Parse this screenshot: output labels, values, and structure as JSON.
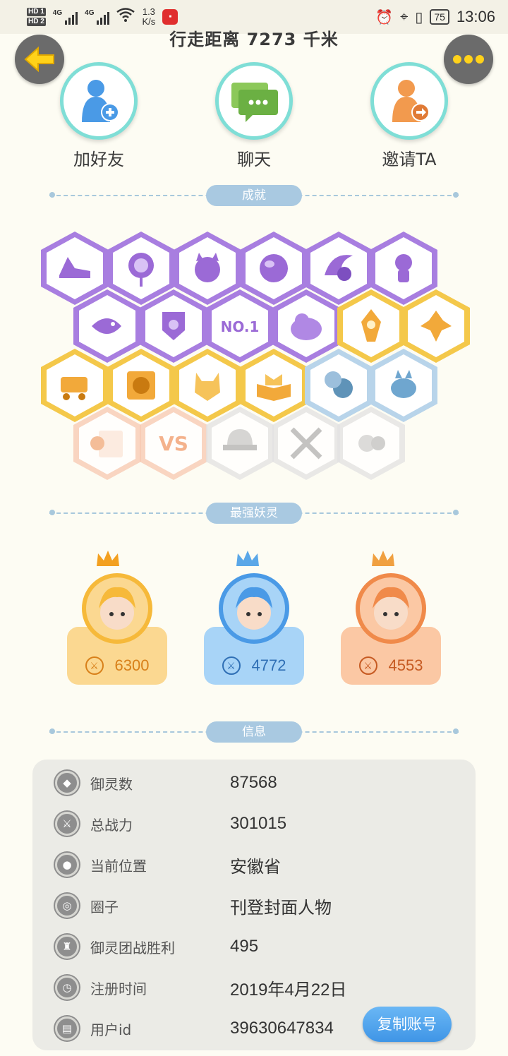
{
  "status_bar": {
    "hd1": "HD 1",
    "hd2": "HD 2",
    "sig1": "4G",
    "sig2": "4G",
    "speed_value": "1.3",
    "speed_unit": "K/s",
    "battery": "75",
    "time": "13:06"
  },
  "header": {
    "distance_text": "行走距离 7273 千米"
  },
  "actions": [
    {
      "label": "加好友",
      "icon": "add-friend-icon"
    },
    {
      "label": "聊天",
      "icon": "chat-icon"
    },
    {
      "label": "邀请TA",
      "icon": "invite-icon"
    }
  ],
  "sections": {
    "achievements": "成就",
    "strongest": "最强妖灵",
    "info": "信息"
  },
  "achievements": [
    {
      "icon": "shoe-icon",
      "color": "#a87ee0"
    },
    {
      "icon": "portal-icon",
      "color": "#a87ee0"
    },
    {
      "icon": "cat-face-icon",
      "color": "#a87ee0"
    },
    {
      "icon": "orb-icon",
      "color": "#a87ee0"
    },
    {
      "icon": "yin-yang-icon",
      "color": "#a87ee0"
    },
    {
      "icon": "cat-spirit-icon",
      "color": "#a87ee0"
    },
    {
      "icon": "fish-spirit-icon",
      "color": "#a87ee0"
    },
    {
      "icon": "shield-icon",
      "color": "#a87ee0"
    },
    {
      "icon": "no1-icon",
      "color": "#a87ee0",
      "text": "NO.1"
    },
    {
      "icon": "blob-icon",
      "color": "#a87ee0"
    },
    {
      "icon": "crystal-icon",
      "color": "#f4c84a"
    },
    {
      "icon": "monster-icon",
      "color": "#f4c84a"
    },
    {
      "icon": "stroller-icon",
      "color": "#f4c84a"
    },
    {
      "icon": "taiji-book-icon",
      "color": "#f4c84a"
    },
    {
      "icon": "fox-icon",
      "color": "#f4c84a"
    },
    {
      "icon": "open-book-icon",
      "color": "#f4c84a"
    },
    {
      "icon": "moon-icon",
      "color": "#b8d4ea"
    },
    {
      "icon": "dragon-icon",
      "color": "#b8d4ea"
    },
    {
      "icon": "scroll-icon",
      "color": "#f7c9b0"
    },
    {
      "icon": "vs-icon",
      "color": "#f7c9b0",
      "text": "VS"
    },
    {
      "icon": "helmet-icon",
      "color": "#e2e2e2"
    },
    {
      "icon": "swords-icon",
      "color": "#e2e2e2"
    },
    {
      "icon": "hearts-icon",
      "color": "#e2e2e2"
    }
  ],
  "spirits": [
    {
      "power": "6300",
      "card_color": "#fbd891",
      "ring_color": "#f6b93a",
      "crown_color": "#f3a020",
      "text_color": "#d8801a"
    },
    {
      "power": "4772",
      "card_color": "#a8d4f7",
      "ring_color": "#4a9ae6",
      "crown_color": "#5aa7e8",
      "text_color": "#2f6fb5"
    },
    {
      "power": "4553",
      "card_color": "#fbc8a4",
      "ring_color": "#f08a4a",
      "crown_color": "#f0a040",
      "text_color": "#c65a22"
    }
  ],
  "info": [
    {
      "icon": "spirit-count-icon",
      "key": "御灵数",
      "value": "87568"
    },
    {
      "icon": "sword-icon",
      "key": "总战力",
      "value": "301015"
    },
    {
      "icon": "location-icon",
      "key": "当前位置",
      "value": "安徽省"
    },
    {
      "icon": "circle-icon",
      "key": "圈子",
      "value": "刊登封面人物"
    },
    {
      "icon": "trophy-icon",
      "key": "御灵团战胜利",
      "value": "495"
    },
    {
      "icon": "clock-icon",
      "key": "注册时间",
      "value": "2019年4月22日"
    },
    {
      "icon": "id-card-icon",
      "key": "用户id",
      "value": "39630647834"
    }
  ],
  "copy_button": "复制账号"
}
